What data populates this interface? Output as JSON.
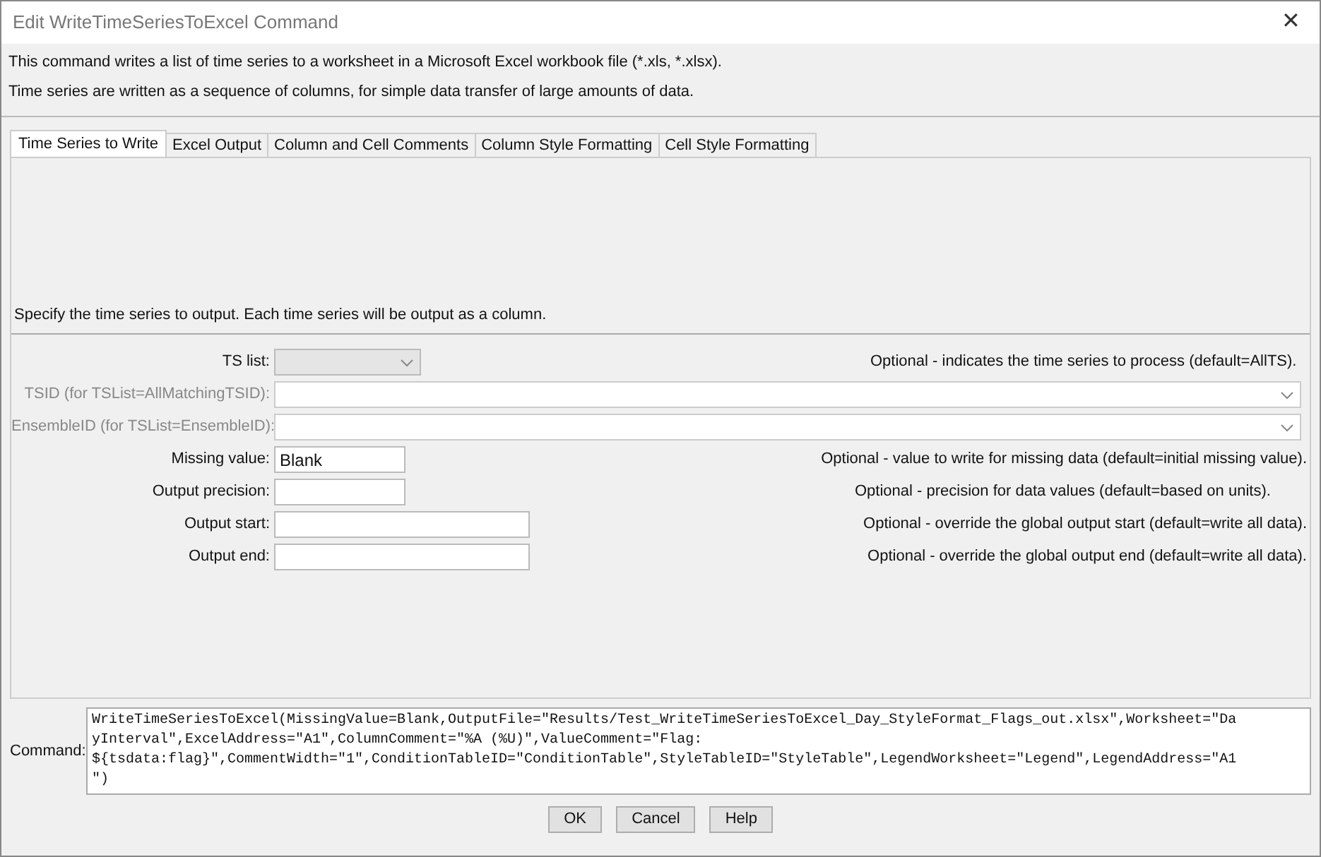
{
  "window": {
    "title": "Edit WriteTimeSeriesToExcel Command",
    "close": "✕"
  },
  "description": [
    "This command writes a list of time series to a worksheet in a Microsoft Excel workbook file (*.xls, *.xlsx).",
    "Time series are written as a sequence of columns, for simple data transfer of large amounts of data."
  ],
  "tabs": [
    {
      "label": "Time Series to Write",
      "selected": true
    },
    {
      "label": "Excel Output",
      "selected": false
    },
    {
      "label": "Column and Cell Comments",
      "selected": false
    },
    {
      "label": "Column Style Formatting",
      "selected": false
    },
    {
      "label": "Cell Style Formatting",
      "selected": false
    }
  ],
  "panel_intro": "Specify the time series to output.  Each time series will be output as a column.",
  "rows": [
    {
      "kind": "select",
      "label": "TS list:",
      "disabled": false,
      "value": "",
      "help": "Optional - indicates the time series to process (default=AllTS)."
    },
    {
      "kind": "combo",
      "label": "TSID (for TSList=AllMatchingTSID):",
      "disabled": true,
      "value": ""
    },
    {
      "kind": "combo",
      "label": "EnsembleID (for TSList=EnsembleID):",
      "disabled": true,
      "value": ""
    },
    {
      "kind": "short",
      "label": "Missing value:",
      "disabled": false,
      "value": "Blank",
      "help": "Optional - value to write for missing data (default=initial missing value)."
    },
    {
      "kind": "short",
      "label": "Output precision:",
      "disabled": false,
      "value": "",
      "help": "Optional - precision for data values (default=based on units)."
    },
    {
      "kind": "long",
      "label": "Output start:",
      "disabled": false,
      "value": "",
      "help": "Optional - override the global output start (default=write all data)."
    },
    {
      "kind": "long",
      "label": "Output end:",
      "disabled": false,
      "value": "",
      "help": "Optional - override the global output end (default=write all data)."
    }
  ],
  "command": {
    "label": "Command:",
    "lines": [
      "WriteTimeSeriesToExcel(MissingValue=Blank,OutputFile=\"Results/Test_WriteTimeSeriesToExcel_Day_StyleFormat_Flags_out.xlsx\",Worksheet=\"Da",
      "yInterval\",ExcelAddress=\"A1\",ColumnComment=\"%A (%U)\",ValueComment=\"Flag:",
      "${tsdata:flag}\",CommentWidth=\"1\",ConditionTableID=\"ConditionTable\",StyleTableID=\"StyleTable\",LegendWorksheet=\"Legend\",LegendAddress=\"A1",
      "\")"
    ]
  },
  "buttons": [
    "OK",
    "Cancel",
    "Help"
  ]
}
